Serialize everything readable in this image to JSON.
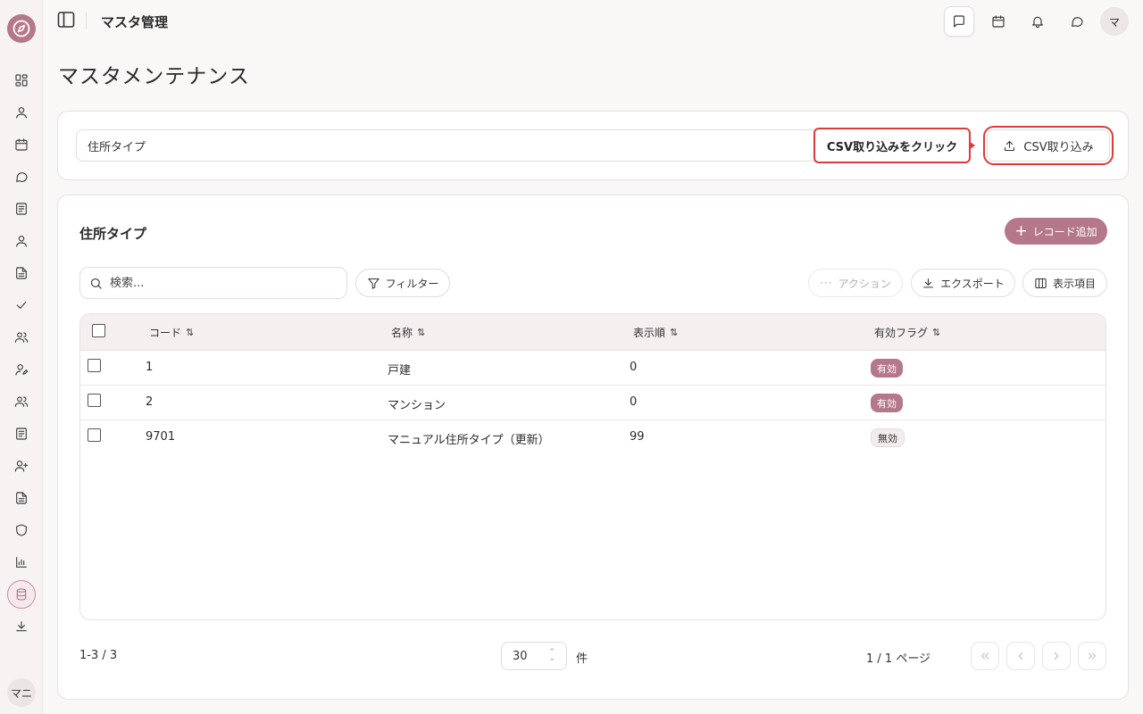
{
  "topbar": {
    "title": "マスタ管理",
    "avatar": "マ"
  },
  "sidebar": {
    "avatar": "マニ",
    "items": [
      "dashboard",
      "user",
      "calendar",
      "chat",
      "book",
      "user",
      "document",
      "check",
      "users",
      "user-edit",
      "users",
      "book",
      "user-plus",
      "document",
      "shield",
      "chart",
      "database",
      "download"
    ]
  },
  "page": {
    "title": "マスタメンテナンス"
  },
  "master_select": {
    "value": "住所タイプ",
    "callout": "CSV取り込みをクリック",
    "csv_button": "CSV取り込み"
  },
  "card": {
    "title": "住所タイプ",
    "add_button": "レコード追加",
    "search_placeholder": "検索...",
    "filter_button": "フィルター",
    "action_button": "アクション",
    "export_button": "エクスポート",
    "columns_button": "表示項目"
  },
  "table": {
    "sort_icon": "⇅",
    "headers": [
      "コード",
      "名称",
      "表示順",
      "有効フラグ"
    ],
    "rows": [
      {
        "code": "1",
        "name": "戸建",
        "order": "0",
        "flag": "有効"
      },
      {
        "code": "2",
        "name": "マンション",
        "order": "0",
        "flag": "有効"
      },
      {
        "code": "9701",
        "name": "マニュアル住所タイプ（更新）",
        "order": "99",
        "flag": "無効"
      }
    ]
  },
  "footer": {
    "range": "1-3 / 3",
    "page_size": "30",
    "unit": "件",
    "page_info": "1 / 1 ページ"
  },
  "colors": {
    "accent": "#b5788a",
    "highlight": "#dc3b3b"
  }
}
